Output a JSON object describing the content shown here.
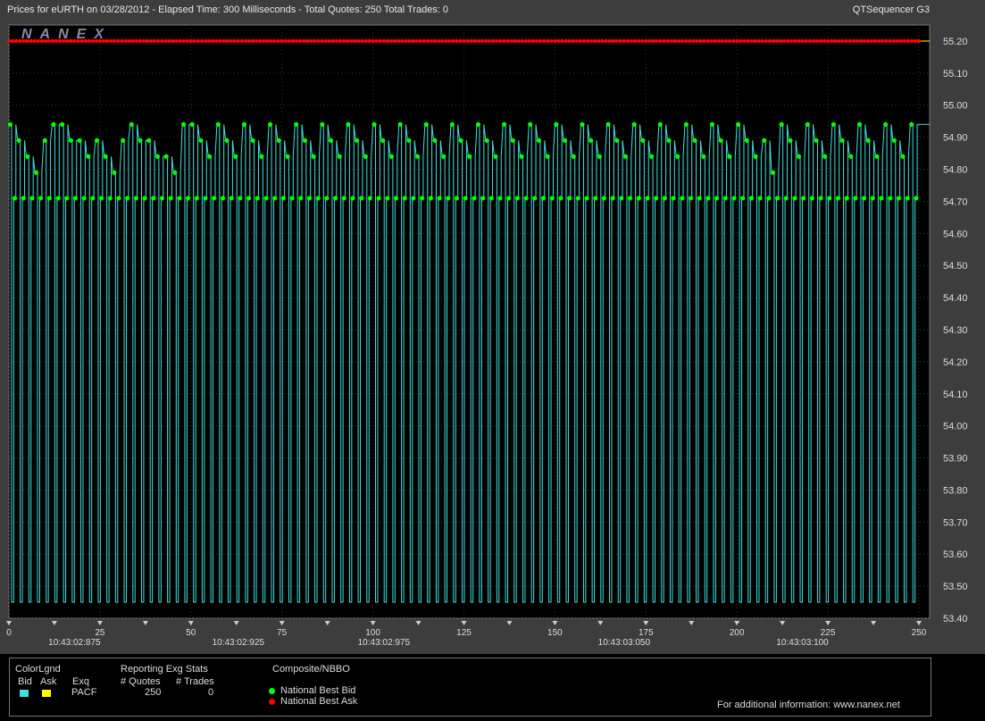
{
  "header": {
    "title": "Prices for  eURTH  on  03/28/2012  -  Elapsed Time: 300 Milliseconds  -  Total Quotes: 250  Total Trades: 0",
    "app_name": "QTSequencer G3",
    "watermark": "NANEX"
  },
  "colors": {
    "background": "#000000",
    "frame": "#3d3d3d",
    "bid_line": "#40e0e0",
    "ask_line": "#ffff00",
    "nbb_dot": "#00ff00",
    "nbo_dot": "#ff0000",
    "grid": "#333333"
  },
  "chart_data": {
    "type": "line",
    "title": "Prices for eURTH on 03/28/2012",
    "xlabel": "",
    "ylabel": "",
    "xlim": [
      0,
      250
    ],
    "ylim": [
      53.4,
      55.25
    ],
    "grid": true,
    "x_ticks": [
      0,
      25,
      50,
      75,
      100,
      125,
      150,
      175,
      200,
      225,
      250
    ],
    "y_ticks": [
      "55.20",
      "55.10",
      "55.00",
      "54.90",
      "54.80",
      "54.70",
      "54.60",
      "54.50",
      "54.40",
      "54.30",
      "54.20",
      "54.10",
      "54.00",
      "53.90",
      "53.80",
      "53.70",
      "53.60",
      "53.50",
      "53.40"
    ],
    "time_labels": [
      {
        "x": 18,
        "label": "10:43:02:875"
      },
      {
        "x": 63,
        "label": "10:43:02:925"
      },
      {
        "x": 103,
        "label": "10:43:02:975"
      },
      {
        "x": 169,
        "label": "10:43:03:050"
      },
      {
        "x": 218,
        "label": "10:43:03:100"
      }
    ],
    "series": [
      {
        "name": "National Best Ask",
        "constant_value": 55.2
      },
      {
        "name": "National Best Bid",
        "high_values": [
          54.94,
          54.89,
          54.84,
          54.79,
          54.89,
          54.94,
          54.94,
          54.89,
          54.89,
          54.84,
          54.89,
          54.84,
          54.79,
          54.89,
          54.94,
          54.89,
          54.89,
          54.84,
          54.84,
          54.79,
          54.94,
          54.94,
          54.89,
          54.84,
          54.94,
          54.89,
          54.84,
          54.94,
          54.89,
          54.84,
          54.94,
          54.89,
          54.84,
          54.94,
          54.89,
          54.84,
          54.94,
          54.89,
          54.84,
          54.94,
          54.89,
          54.84,
          54.94,
          54.89,
          54.84,
          54.94,
          54.89,
          54.84,
          54.94,
          54.89,
          54.84,
          54.94,
          54.89,
          54.84,
          54.94,
          54.89,
          54.84,
          54.94,
          54.89,
          54.84,
          54.94,
          54.89,
          54.84,
          54.94,
          54.89,
          54.84,
          54.94,
          54.89,
          54.84,
          54.94,
          54.89,
          54.84,
          54.94,
          54.89,
          54.84,
          54.94,
          54.89,
          54.84,
          54.94,
          54.89,
          54.84,
          54.94,
          54.89,
          54.84,
          54.94,
          54.89,
          54.84,
          54.89,
          54.79,
          54.94,
          54.89,
          54.84,
          54.94,
          54.89,
          54.84,
          54.94,
          54.89,
          54.84,
          54.94,
          54.89,
          54.84,
          54.94,
          54.89,
          54.84,
          54.94
        ],
        "mid_value": 54.71,
        "low_value": 53.45
      }
    ]
  },
  "legend": {
    "color_legend_title": "ColorLgnd",
    "bid_label": "Bid",
    "ask_label": "Ask",
    "exchange_header": "Exq",
    "exchange_value": "PACF",
    "reporting_title": "Reporting Exg Stats",
    "quotes_header": "# Quotes",
    "quotes_value": "250",
    "trades_header": "# Trades",
    "trades_value": "0",
    "composite_title": "Composite/NBBO",
    "nbb_label": "National Best Bid",
    "nbo_label": "National Best Ask",
    "info_text": "For additional information: www.nanex.net"
  }
}
